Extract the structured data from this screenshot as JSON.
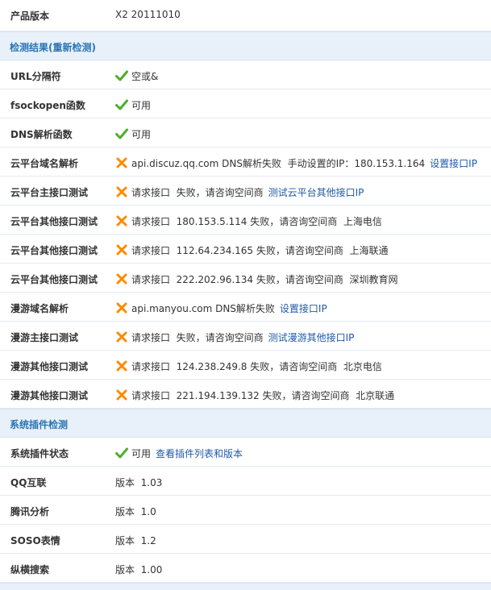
{
  "colors": {
    "section_bg": "#e8f1fa",
    "section_text": "#2a74b4",
    "link": "#1f5aa6",
    "ok": "#4caf2a",
    "fail": "#ff8a00"
  },
  "product": {
    "label": "产品版本",
    "value": "X2 20111010"
  },
  "sections": [
    {
      "title": "检测结果(重新检测)",
      "rows": [
        {
          "label": "URL分隔符",
          "status": "ok",
          "text": "空或&",
          "link": ""
        },
        {
          "label": "fsockopen函数",
          "status": "ok",
          "text": "可用",
          "link": ""
        },
        {
          "label": "DNS解析函数",
          "status": "ok",
          "text": "可用",
          "link": ""
        },
        {
          "label": "云平台域名解析",
          "status": "fail",
          "text": "api.discuz.qq.com DNS解析失败  手动设置的IP：180.153.1.164",
          "link": "设置接口IP"
        },
        {
          "label": "云平台主接口测试",
          "status": "fail",
          "text": "请求接口  失败，请咨询空间商",
          "link": "测试云平台其他接口IP"
        },
        {
          "label": "云平台其他接口测试",
          "status": "fail",
          "text": "请求接口  180.153.5.114 失败，请咨询空间商  上海电信",
          "link": ""
        },
        {
          "label": "云平台其他接口测试",
          "status": "fail",
          "text": "请求接口  112.64.234.165 失败，请咨询空间商  上海联通",
          "link": ""
        },
        {
          "label": "云平台其他接口测试",
          "status": "fail",
          "text": "请求接口  222.202.96.134 失败，请咨询空间商  深圳教育网",
          "link": ""
        },
        {
          "label": "漫游域名解析",
          "status": "fail",
          "text": "api.manyou.com DNS解析失败",
          "link": "设置接口IP"
        },
        {
          "label": "漫游主接口测试",
          "status": "fail",
          "text": "请求接口  失败，请咨询空间商",
          "link": "测试漫游其他接口IP"
        },
        {
          "label": "漫游其他接口测试",
          "status": "fail",
          "text": "请求接口  124.238.249.8 失败，请咨询空间商  北京电信",
          "link": ""
        },
        {
          "label": "漫游其他接口测试",
          "status": "fail",
          "text": "请求接口  221.194.139.132 失败，请咨询空间商  北京联通",
          "link": ""
        }
      ]
    },
    {
      "title": "系统插件检测",
      "rows": [
        {
          "label": "系统插件状态",
          "status": "ok",
          "text": "可用",
          "link": "查看插件列表和版本"
        },
        {
          "label": "QQ互联",
          "status": "",
          "text": "版本  1.03",
          "link": ""
        },
        {
          "label": "腾讯分析",
          "status": "",
          "text": "版本  1.0",
          "link": ""
        },
        {
          "label": "SOSO表情",
          "status": "",
          "text": "版本  1.2",
          "link": ""
        },
        {
          "label": "纵横搜索",
          "status": "",
          "text": "版本  1.00",
          "link": ""
        }
      ]
    }
  ]
}
